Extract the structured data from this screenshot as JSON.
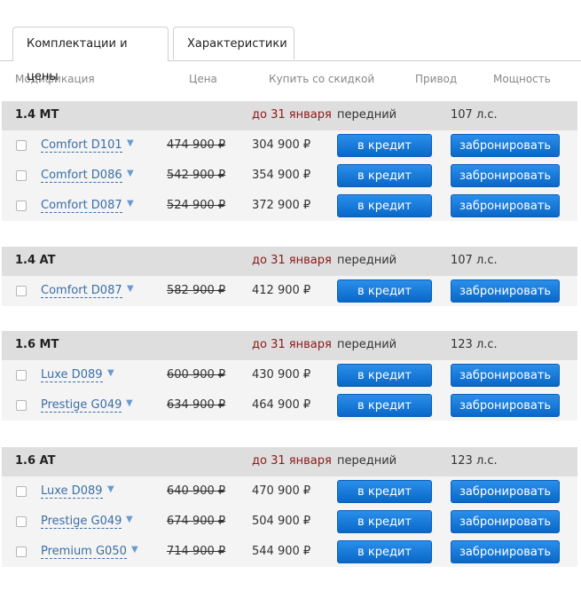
{
  "tabs": [
    "Комплектации и цены",
    "Характеристики"
  ],
  "columns": [
    "Модификация",
    "Цена",
    "Купить со скидкой",
    "Привод",
    "Мощность"
  ],
  "currency": "₽",
  "buttons": {
    "credit": "в кредит",
    "book": "забронировать"
  },
  "groups": [
    {
      "name": "1.4 MT",
      "deadline": "до 31 января",
      "drive": "передний",
      "power": "107 л.с.",
      "rows": [
        {
          "mod": "Comfort D101",
          "old": "474 900 ₽",
          "price": "304 900 ₽"
        },
        {
          "mod": "Comfort D086",
          "old": "542 900 ₽",
          "price": "354 900 ₽"
        },
        {
          "mod": "Comfort D087",
          "old": "524 900 ₽",
          "price": "372 900 ₽"
        }
      ]
    },
    {
      "name": "1.4 AT",
      "deadline": "до 31 января",
      "drive": "передний",
      "power": "107 л.с.",
      "rows": [
        {
          "mod": "Comfort D087",
          "old": "582 900 ₽",
          "price": "412 900 ₽"
        }
      ]
    },
    {
      "name": "1.6 MT",
      "deadline": "до 31 января",
      "drive": "передний",
      "power": "123 л.с.",
      "rows": [
        {
          "mod": "Luxe D089",
          "old": "600 900 ₽",
          "price": "430 900 ₽"
        },
        {
          "mod": "Prestige G049",
          "old": "634 900 ₽",
          "price": "464 900 ₽"
        }
      ]
    },
    {
      "name": "1.6 AT",
      "deadline": "до 31 января",
      "drive": "передний",
      "power": "123 л.с.",
      "rows": [
        {
          "mod": "Luxe D089",
          "old": "640 900 ₽",
          "price": "470 900 ₽"
        },
        {
          "mod": "Prestige G049",
          "old": "674 900 ₽",
          "price": "504 900 ₽"
        },
        {
          "mod": "Premium G050",
          "old": "714 900 ₽",
          "price": "544 900 ₽"
        }
      ]
    }
  ]
}
